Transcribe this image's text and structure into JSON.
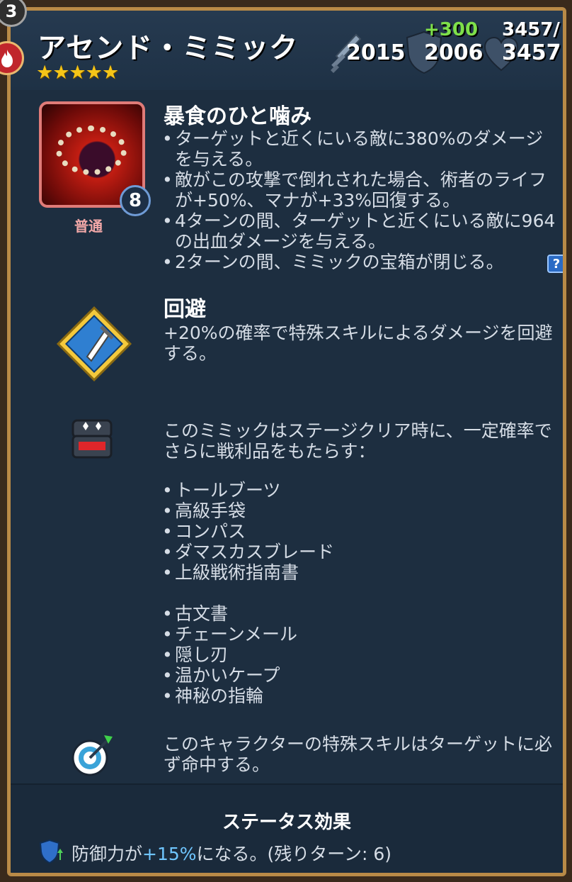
{
  "hero": {
    "level": "3",
    "name": "アセンド・ミミック",
    "stars": "★★★★★",
    "attack": "2015",
    "defense_bonus": "+300",
    "defense": "2006",
    "health_current": "3457/",
    "health_max": "3457"
  },
  "portrait": {
    "rank": "8",
    "rarity": "普通"
  },
  "special_skill": {
    "title": "暴食のひと噛み",
    "bullets": [
      "ターゲットと近くにいる敵に380%のダメージを与える。",
      "敵がこの攻撃で倒れされた場合、術者のライフが+50%、マナが+33%回復する。",
      "4ターンの間、ターゲットと近くにいる敵に964の出血ダメージを与える。",
      "2ターンの間、ミミックの宝箱が閉じる。"
    ],
    "help_label": "?"
  },
  "dodge_skill": {
    "title": "回避",
    "description": "+20%の確率で特殊スキルによるダメージを回避する。"
  },
  "loot": {
    "description": "このミミックはステージクリア時に、一定確率でさらに戦利品をもたらす：",
    "group_a": [
      "トールブーツ",
      "高級手袋",
      "コンパス",
      "ダマスカスブレード",
      "上級戦術指南書"
    ],
    "group_b": [
      "古文書",
      "チェーンメール",
      "隠し刃",
      "温かいケープ",
      "神秘の指輪"
    ]
  },
  "accuracy": {
    "description": "このキャラクターの特殊スキルはターゲットに必ず命中する。"
  },
  "status": {
    "title": "ステータス効果",
    "text_before": "防御力が",
    "value": "+15%",
    "text_after": "になる。(残りターン: 6)"
  },
  "icons": {
    "level": "level-badge",
    "element": "fire-icon",
    "attack": "sword-icon",
    "defense": "shield-icon",
    "health": "heart-icon",
    "dodge": "dagger-icon",
    "loot": "chest-icon",
    "accuracy": "target-icon",
    "status": "shield-up-icon"
  },
  "colors": {
    "panel": "#1d2e40",
    "frame": "#b98a47",
    "stars": "#f5c518",
    "bonus_green": "#7ee04a",
    "highlight_blue": "#6fc6ff"
  }
}
